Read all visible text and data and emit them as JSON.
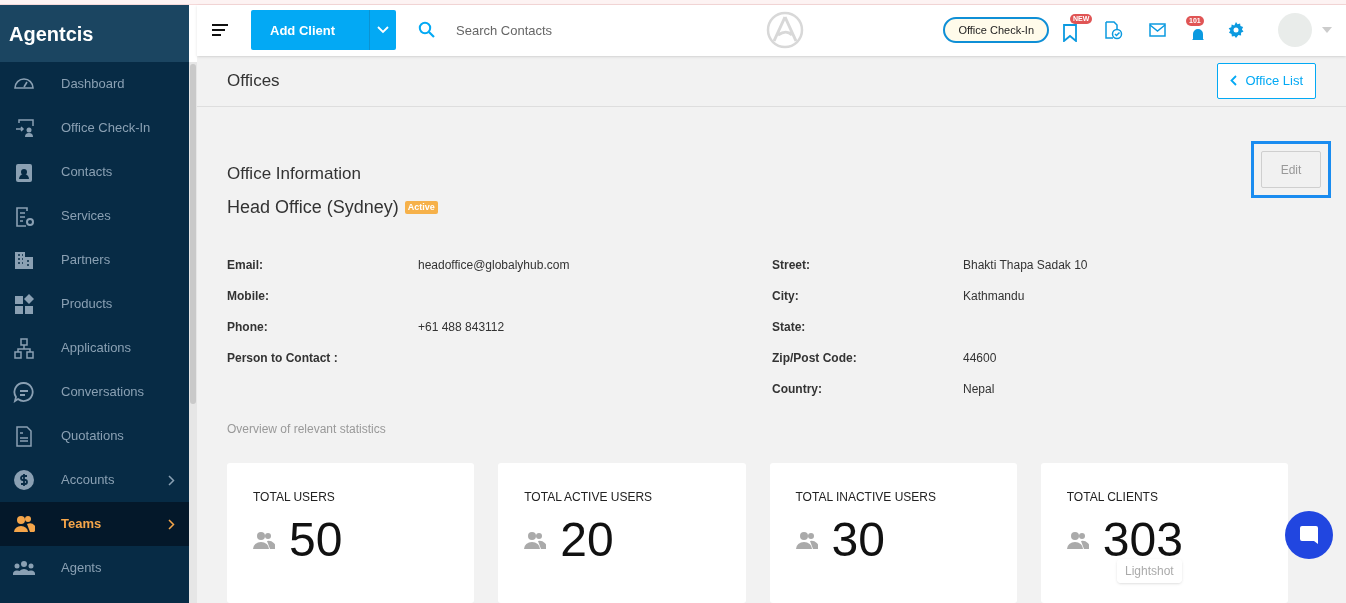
{
  "brand": "Agentcis",
  "sidebar": {
    "items": [
      {
        "label": "Dashboard",
        "selected": false,
        "has_submenu": false
      },
      {
        "label": "Office Check-In",
        "selected": false,
        "has_submenu": false
      },
      {
        "label": "Contacts",
        "selected": false,
        "has_submenu": false
      },
      {
        "label": "Services",
        "selected": false,
        "has_submenu": false
      },
      {
        "label": "Partners",
        "selected": false,
        "has_submenu": false
      },
      {
        "label": "Products",
        "selected": false,
        "has_submenu": false
      },
      {
        "label": "Applications",
        "selected": false,
        "has_submenu": false
      },
      {
        "label": "Conversations",
        "selected": false,
        "has_submenu": false
      },
      {
        "label": "Quotations",
        "selected": false,
        "has_submenu": false
      },
      {
        "label": "Accounts",
        "selected": false,
        "has_submenu": true
      },
      {
        "label": "Teams",
        "selected": true,
        "has_submenu": true
      },
      {
        "label": "Agents",
        "selected": false,
        "has_submenu": false
      }
    ]
  },
  "header": {
    "add_button": "Add Client",
    "search": {
      "placeholder": "Search Contacts"
    },
    "checkin_button": "Office Check-In",
    "new_badge": "NEW",
    "notification_count": "101"
  },
  "page": {
    "title": "Offices",
    "back_button": "Office List"
  },
  "office": {
    "section_title": "Office Information",
    "edit_button": "Edit",
    "name": "Head Office (Sydney)",
    "status": "Active",
    "left_fields": [
      {
        "label": "Email:",
        "value": "headoffice@globalyhub.com"
      },
      {
        "label": "Mobile:"
      },
      {
        "label": "Phone:",
        "value": "+61 488 843112"
      },
      {
        "label": "Person to Contact :"
      }
    ],
    "right_fields": [
      {
        "label": "Street:",
        "value": "Bhakti Thapa Sadak 10"
      },
      {
        "label": "City:",
        "value": "Kathmandu"
      },
      {
        "label": "State:"
      },
      {
        "label": "Zip/Post Code:",
        "value": "44600"
      },
      {
        "label": "Country:",
        "value": "Nepal"
      }
    ],
    "stats_caption": "Overview of relevant statistics",
    "stats": [
      {
        "label": "TOTAL USERS",
        "value": "50"
      },
      {
        "label": "TOTAL ACTIVE USERS",
        "value": "20"
      },
      {
        "label": "TOTAL INACTIVE USERS",
        "value": "30"
      },
      {
        "label": "TOTAL CLIENTS",
        "value": "303"
      }
    ]
  },
  "tooltip": "Lightshot"
}
